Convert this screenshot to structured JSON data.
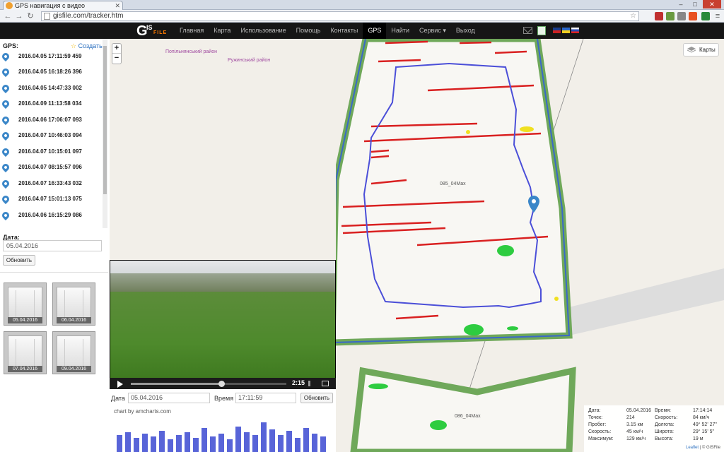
{
  "browser": {
    "tab_title": "GPS навигация с видео",
    "url": "gisfile.com/tracker.htm"
  },
  "site": {
    "logo_g": "G",
    "logo_is": "IS",
    "logo_file": "FILE",
    "menu": [
      {
        "label": "Главная"
      },
      {
        "label": "Карта"
      },
      {
        "label": "Использование"
      },
      {
        "label": "Помощь"
      },
      {
        "label": "Контакты"
      },
      {
        "label": "GPS"
      },
      {
        "label": "Найти"
      },
      {
        "label": "Сервис ▾"
      },
      {
        "label": "Выход"
      }
    ],
    "active_menu": "GPS"
  },
  "sidebar": {
    "header": "GPS:",
    "create_label": "Создать",
    "tracks": [
      {
        "label": "2016.04.05 17:11:59 459"
      },
      {
        "label": "2016.04.05 16:18:26 396"
      },
      {
        "label": "2016.04.05 14:47:33 002"
      },
      {
        "label": "2016.04.09 11:13:58 034"
      },
      {
        "label": "2016.04.06 17:06:07 093"
      },
      {
        "label": "2016.04.07 10:46:03 094"
      },
      {
        "label": "2016.04.07 10:15:01 097"
      },
      {
        "label": "2016.04.07 08:15:57 096"
      },
      {
        "label": "2016.04.07 16:33:43 032"
      },
      {
        "label": "2016.04.07 15:01:13 075"
      },
      {
        "label": "2016.04.06 16:15:29 086"
      }
    ],
    "date_label": "Дата:",
    "date_value": "05.04.2016",
    "refresh_label": "Обновить",
    "thumbs": [
      {
        "caption": "05.04.2016"
      },
      {
        "caption": "06.04.2016"
      },
      {
        "caption": "07.04.2016"
      },
      {
        "caption": "09.04.2016"
      }
    ]
  },
  "video": {
    "time": "2:15",
    "progress": 0.58,
    "date_label": "Дата",
    "date_value": "05.04.2016",
    "time_label": "Время",
    "time_value": "17:11:59",
    "refresh_label": "Обновить",
    "chart_credit": "chart by amcharts.com"
  },
  "map": {
    "zoom_in": "+",
    "zoom_out": "−",
    "layers_label": "Карты",
    "region_1": "Попільнянський район",
    "region_2": "Ружинський район",
    "field_1": "085_04Мах",
    "field_2": "086_04Мах",
    "attribution_leaflet": "Leaflet",
    "attribution_sep": " | © GISFile"
  },
  "info": {
    "date_k": "Дата:",
    "date_v": "05.04.2016",
    "time_k": "Время:",
    "time_v": "17:14:14",
    "points_k": "Точек:",
    "points_v": "214",
    "speed_k": "Скорость:",
    "speed_v": "84 км/ч",
    "mileage_k": "Пробег:",
    "mileage_v": "3.15 км",
    "lon_k": "Долгота:",
    "lon_v": "49° 52' 27\"",
    "speed2_k": "Скорость:",
    "speed2_v": "45 км/ч",
    "lat_k": "Широта:",
    "lat_v": "29° 15' 5\"",
    "max_k": "Максимум:",
    "max_v": "129 км/ч",
    "alt_k": "Высота:",
    "alt_v": "19 м"
  },
  "colors": {
    "header_bg": "#161616",
    "track_blue": "#4b4fd8",
    "row_red": "#d92020",
    "edge_green": "#6fa85a",
    "accent_orange": "#ff7a00"
  }
}
